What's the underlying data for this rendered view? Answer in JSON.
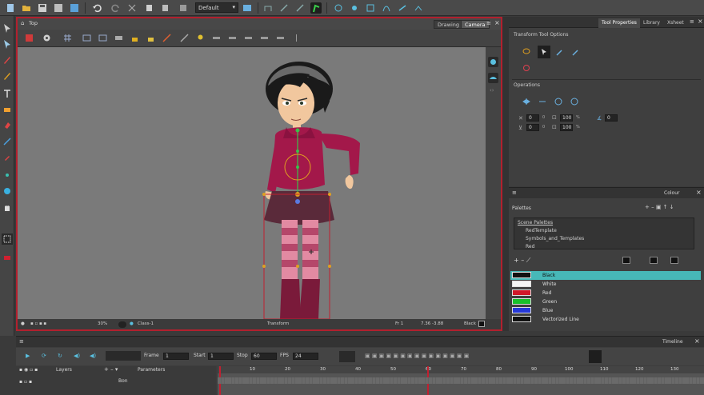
{
  "topbar": {
    "layout_preset": "Default"
  },
  "view": {
    "breadcrumb": "Top",
    "tabs": [
      {
        "label": "Drawing",
        "active": false
      },
      {
        "label": "Camera",
        "active": true
      }
    ],
    "status": {
      "zoom": "30%",
      "element": "Class-1",
      "tool": "Transform",
      "frame": "Fr 1",
      "coords": "7.36 -3.88",
      "color": "Black"
    }
  },
  "right_panel": {
    "tabs": [
      {
        "label": "Tool Properties",
        "active": true
      },
      {
        "label": "Library",
        "active": false
      },
      {
        "label": "Xsheet",
        "active": false
      }
    ],
    "transform_tool_options": "Transform Tool Options",
    "operations": "Operations",
    "fields": {
      "x": "0",
      "y": "0",
      "width": "100",
      "height": "100",
      "w_unit": "%",
      "h_unit": "%",
      "angle": "0",
      "x_unit": "0",
      "y_unit": "0"
    }
  },
  "color_panel": {
    "title": "Colour",
    "palettes_label": "Palettes",
    "scene_palettes": "Scene Palettes",
    "palettes": [
      {
        "name": "RedTemplate"
      },
      {
        "name": "Symbols_and_Templates"
      },
      {
        "name": "Red"
      }
    ],
    "swatches": [
      {
        "name": "Black",
        "hex": "#111111",
        "selected": true
      },
      {
        "name": "White",
        "hex": "#f4f4f4",
        "selected": false
      },
      {
        "name": "Red",
        "hex": "#d0182a",
        "selected": false
      },
      {
        "name": "Green",
        "hex": "#18c12b",
        "selected": false
      },
      {
        "name": "Blue",
        "hex": "#2538d8",
        "selected": false
      },
      {
        "name": "Vectorized Line",
        "hex": "#111111",
        "selected": false
      }
    ]
  },
  "timeline": {
    "title": "Timeline",
    "frame_label": "Frame",
    "frame_value": "1",
    "start_label": "Start",
    "start_value": "1",
    "stop_label": "Stop",
    "stop_value": "60",
    "fps_label": "FPS",
    "fps_value": "24",
    "layers_label": "Layers",
    "parameters_label": "Parameters",
    "layer_name": "Bon",
    "ruler": [
      "10",
      "20",
      "30",
      "40",
      "50",
      "60",
      "70",
      "80",
      "90",
      "100",
      "110",
      "120",
      "130"
    ]
  },
  "colors": {
    "accent_red": "#b2202e",
    "selection_teal": "#47b8b8",
    "canvas_gray": "#7a7a7a"
  }
}
